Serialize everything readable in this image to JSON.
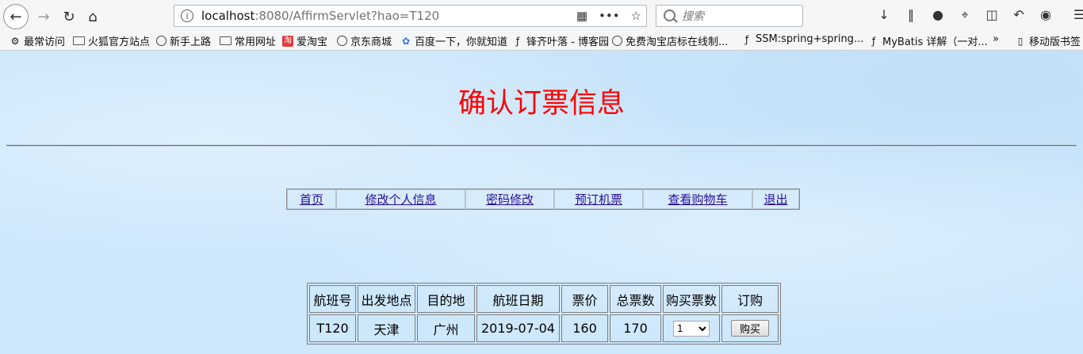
{
  "browser": {
    "url_prefix": "localhost",
    "url_rest": ":8080/AffirmServlet?hao=T120",
    "search_placeholder": "搜索",
    "bookmarks": [
      "最常访问",
      "火狐官方站点",
      "新手上路",
      "常用网址",
      "爱淘宝",
      "京东商城",
      "百度一下，你就知道",
      "锋齐叶落 - 博客园",
      "免费淘宝店标在线制...",
      "SSM:spring+spring...",
      "MyBatis 详解（一对...",
      "移动版书签"
    ]
  },
  "page": {
    "title": "确认订票信息",
    "nav": [
      "首页",
      "修改个人信息",
      "密码修改",
      "预订机票",
      "查看购物车",
      "退出"
    ]
  },
  "ticket": {
    "headers": [
      "航班号",
      "出发地点",
      "目的地",
      "航班日期",
      "票价",
      "总票数",
      "购买票数",
      "订购"
    ],
    "row": {
      "flight_no": "T120",
      "from": "天津",
      "to": "广州",
      "date": "2019-07-04",
      "price": "160",
      "total": "170",
      "qty": "1",
      "buy_label": "购买"
    }
  }
}
